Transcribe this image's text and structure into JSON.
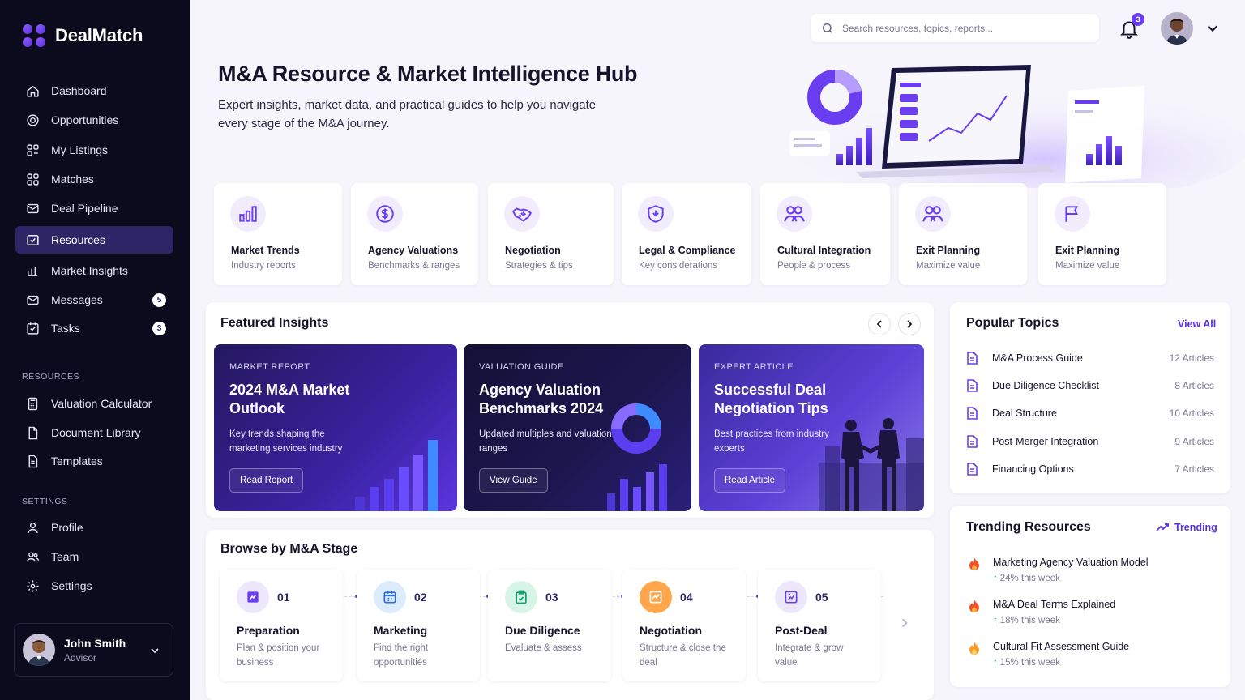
{
  "brand": {
    "name": "DealMatch"
  },
  "colors": {
    "accent": "#6a3df0",
    "sidebar_bg": "#0c0b1e",
    "active_bg": "#2d2565",
    "page_bg": "#f6f5fb",
    "up": "#1aa35a",
    "fire": "#f0502b"
  },
  "sidebar": {
    "nav": [
      {
        "label": "Dashboard",
        "icon": "home-icon"
      },
      {
        "label": "Opportunities",
        "icon": "target-icon"
      },
      {
        "label": "My Listings",
        "icon": "listings-icon"
      },
      {
        "label": "Matches",
        "icon": "matches-icon"
      },
      {
        "label": "Deal Pipeline",
        "icon": "pipeline-icon"
      },
      {
        "label": "Resources",
        "icon": "resources-icon",
        "active": true
      },
      {
        "label": "Market Insights",
        "icon": "bar-chart-icon"
      },
      {
        "label": "Messages",
        "icon": "mail-icon",
        "badge": "5"
      },
      {
        "label": "Tasks",
        "icon": "checkbox-icon",
        "badge": "3"
      }
    ],
    "resources_section": "RESOURCES",
    "resources": [
      {
        "label": "Valuation Calculator",
        "icon": "calculator-icon"
      },
      {
        "label": "Document Library",
        "icon": "document-icon"
      },
      {
        "label": "Templates",
        "icon": "template-icon"
      }
    ],
    "settings_section": "SETTINGS",
    "settings": [
      {
        "label": "Profile",
        "icon": "user-icon"
      },
      {
        "label": "Team",
        "icon": "team-icon"
      },
      {
        "label": "Settings",
        "icon": "gear-icon"
      }
    ],
    "user": {
      "name": "John Smith",
      "role": "Advisor"
    }
  },
  "topbar": {
    "search_placeholder": "Search resources, topics, reports...",
    "notifications": "3"
  },
  "hero": {
    "title": "M&A Resource & Market Intelligence Hub",
    "subtitle": "Expert insights, market data, and practical guides to help you navigate every stage of the M&A journey."
  },
  "categories": [
    {
      "title": "Market Trends",
      "sub": "Industry reports",
      "icon": "bar-chart-icon"
    },
    {
      "title": "Agency Valuations",
      "sub": "Benchmarks & ranges",
      "icon": "dollar-icon"
    },
    {
      "title": "Negotiation",
      "sub": "Strategies & tips",
      "icon": "handshake-icon"
    },
    {
      "title": "Legal & Compliance",
      "sub": "Key considerations",
      "icon": "shield-icon"
    },
    {
      "title": "Cultural Integration",
      "sub": "People & process",
      "icon": "people-icon"
    },
    {
      "title": "Exit Planning",
      "sub": "Maximize value",
      "icon": "people-icon"
    },
    {
      "title": "Exit Planning",
      "sub": "Maximize value",
      "icon": "flag-icon"
    }
  ],
  "featured": {
    "title": "Featured Insights",
    "cards": [
      {
        "kicker": "MARKET REPORT",
        "title": "2024 M&A Market Outlook",
        "desc": "Key trends shaping the marketing services industry",
        "button": "Read Report"
      },
      {
        "kicker": "VALUATION GUIDE",
        "title": "Agency Valuation Benchmarks 2024",
        "desc": "Updated multiples and valuation ranges",
        "button": "View Guide"
      },
      {
        "kicker": "EXPERT ARTICLE",
        "title": "Successful Deal Negotiation Tips",
        "desc": "Best practices from industry experts",
        "button": "Read Article"
      }
    ]
  },
  "stages": {
    "title": "Browse by M&A Stage",
    "items": [
      {
        "num": "01",
        "title": "Preparation",
        "desc": "Plan & position your business",
        "color": "#ece7fd",
        "icon": "prep-icon"
      },
      {
        "num": "02",
        "title": "Marketing",
        "desc": "Find the right opportunities",
        "color": "#dcecfd",
        "icon": "calendar-icon"
      },
      {
        "num": "03",
        "title": "Due Diligence",
        "desc": "Evaluate & assess",
        "color": "#d7f5e7",
        "icon": "clipboard-icon"
      },
      {
        "num": "04",
        "title": "Negotiation",
        "desc": "Structure & close the deal",
        "color": "#ffa64d",
        "icon": "negotiation-icon"
      },
      {
        "num": "05",
        "title": "Post-Deal",
        "desc": "Integrate & grow value",
        "color": "#ece7fd",
        "icon": "integrate-icon"
      }
    ]
  },
  "popular": {
    "title": "Popular Topics",
    "view_all": "View All",
    "items": [
      {
        "name": "M&A Process Guide",
        "count": "12 Articles"
      },
      {
        "name": "Due Diligence Checklist",
        "count": "8 Articles"
      },
      {
        "name": "Deal Structure",
        "count": "10 Articles"
      },
      {
        "name": "Post-Merger Integration",
        "count": "9 Articles"
      },
      {
        "name": "Financing Options",
        "count": "7 Articles"
      }
    ]
  },
  "trending": {
    "title": "Trending Resources",
    "link": "Trending",
    "items": [
      {
        "name": "Marketing Agency Valuation Model",
        "stat": "24% this week"
      },
      {
        "name": "M&A Deal Terms Explained",
        "stat": "18% this week"
      },
      {
        "name": "Cultural Fit Assessment Guide",
        "stat": "15% this week"
      }
    ]
  }
}
